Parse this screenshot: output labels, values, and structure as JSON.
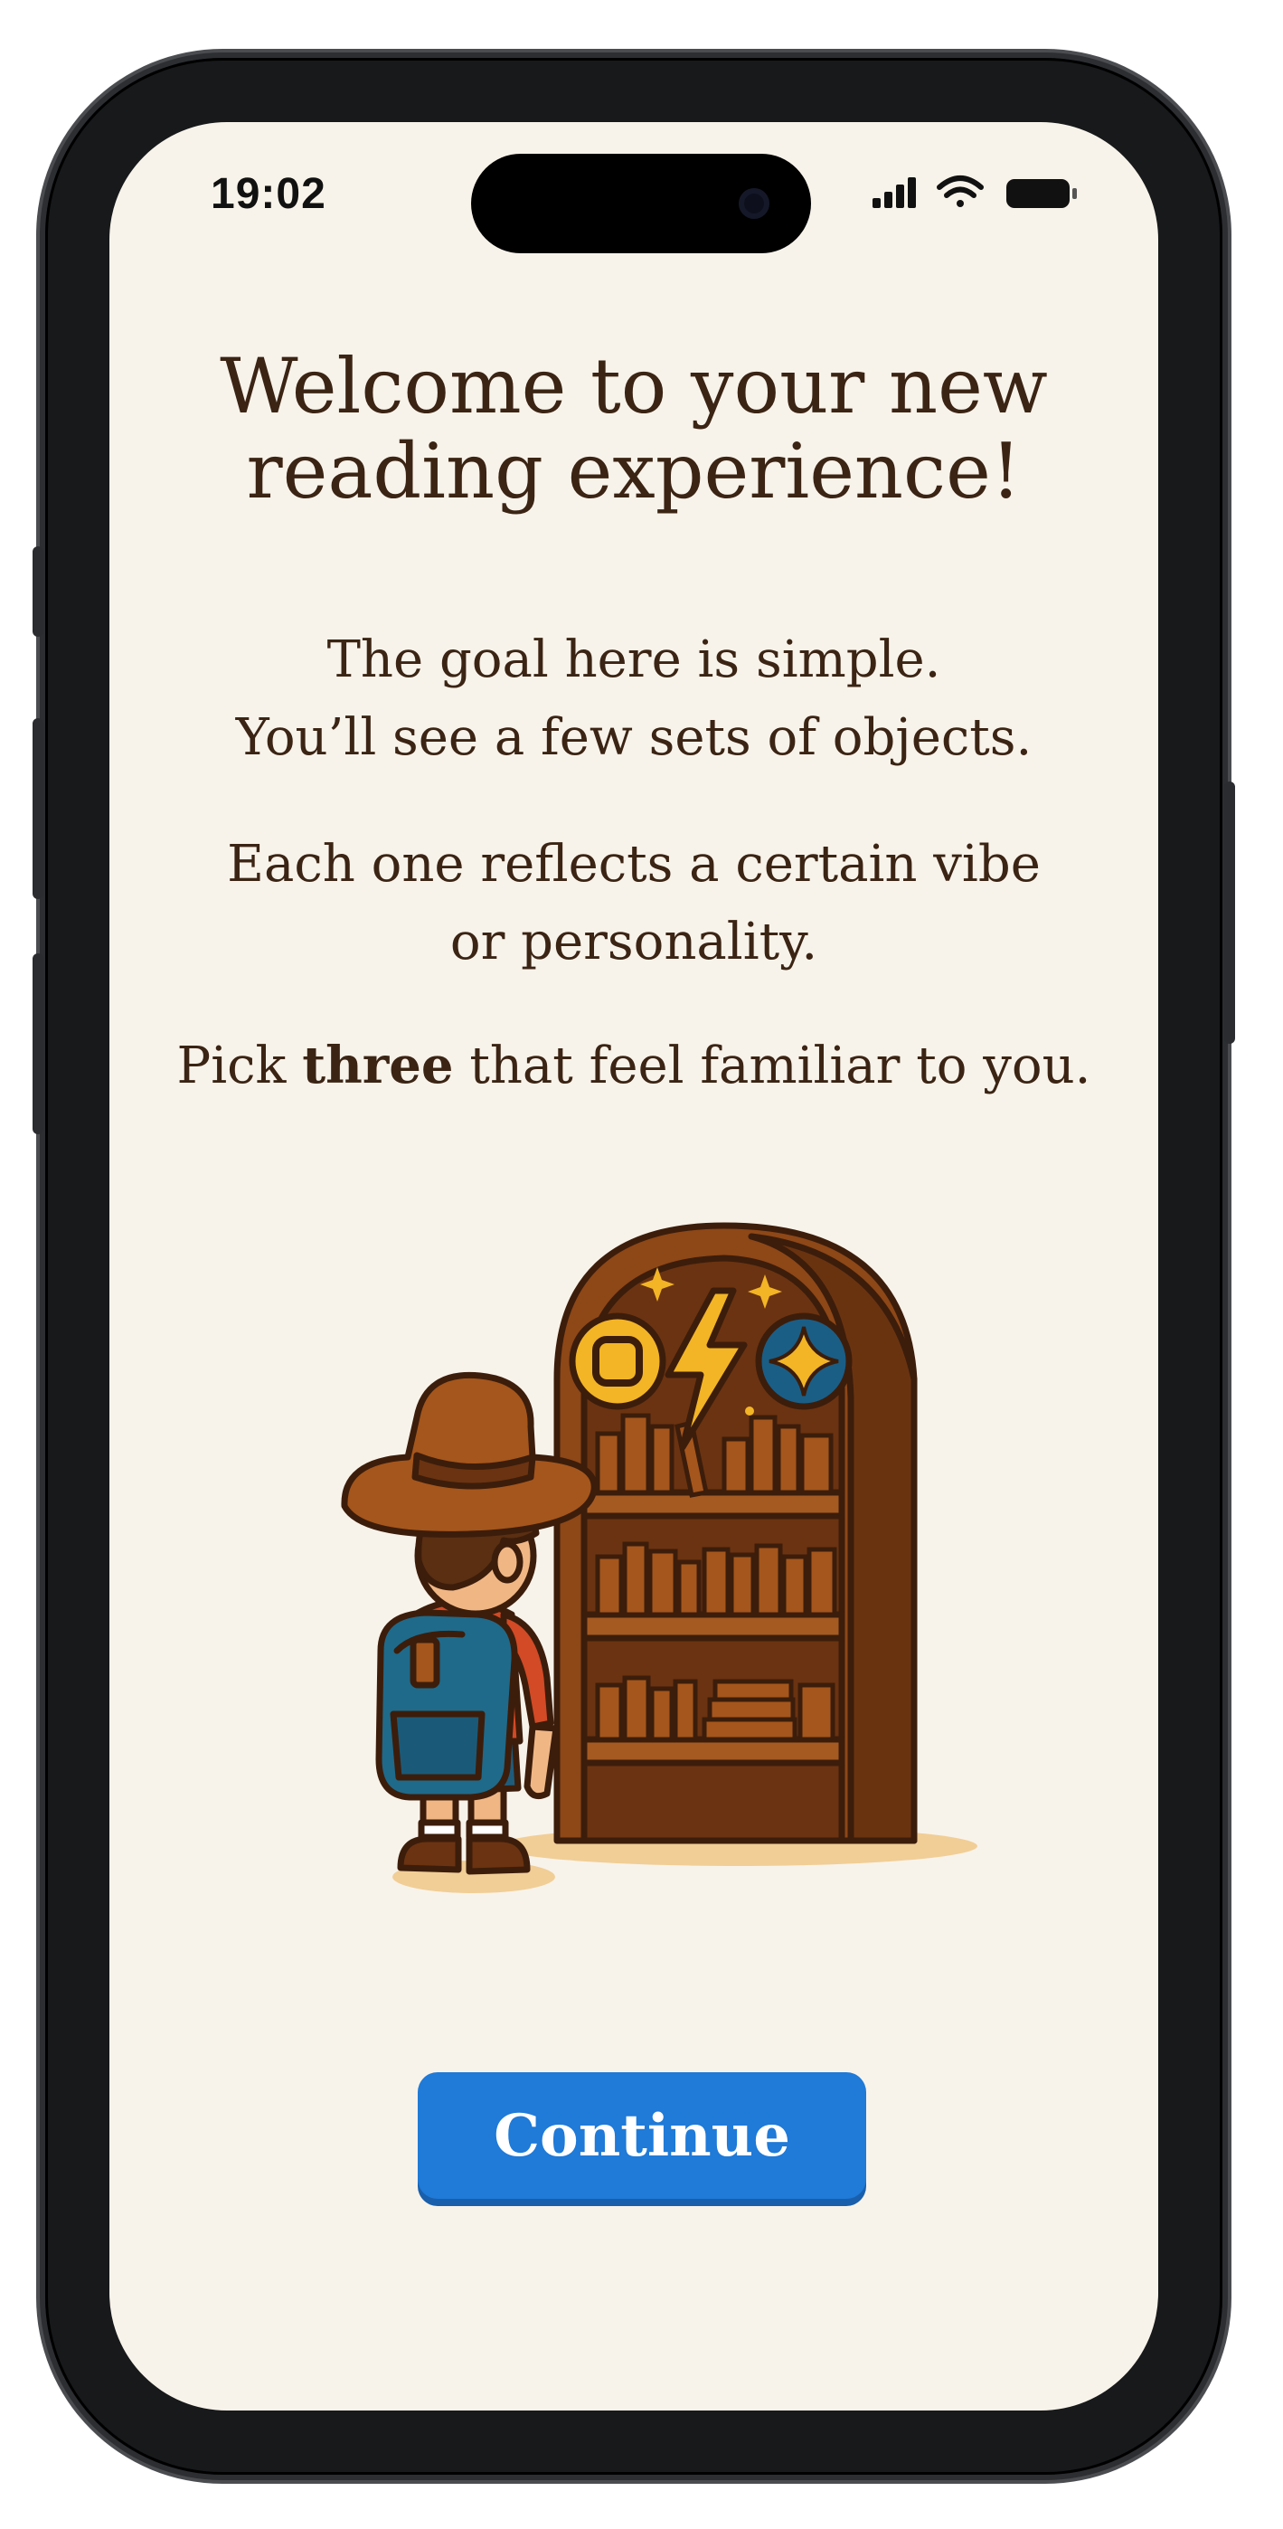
{
  "status_bar": {
    "time": "19:02",
    "icons": [
      "signal-icon",
      "wifi-icon",
      "battery-icon"
    ]
  },
  "onboarding": {
    "title_line1": "Welcome to your new",
    "title_line2": "reading experience!",
    "paragraph1_line1": "The goal here is simple.",
    "paragraph1_line2": "You’ll see a few sets of objects.",
    "paragraph2_line1": "Each one reflects a certain vibe",
    "paragraph2_line2": "or personality.",
    "paragraph3_before": "Pick ",
    "paragraph3_bold": "three",
    "paragraph3_after": " that feel familiar to you.",
    "continue_label": "Continue"
  },
  "colors": {
    "background": "#f8f3ea",
    "text": "#3b2414",
    "button": "#1f7ad8"
  }
}
